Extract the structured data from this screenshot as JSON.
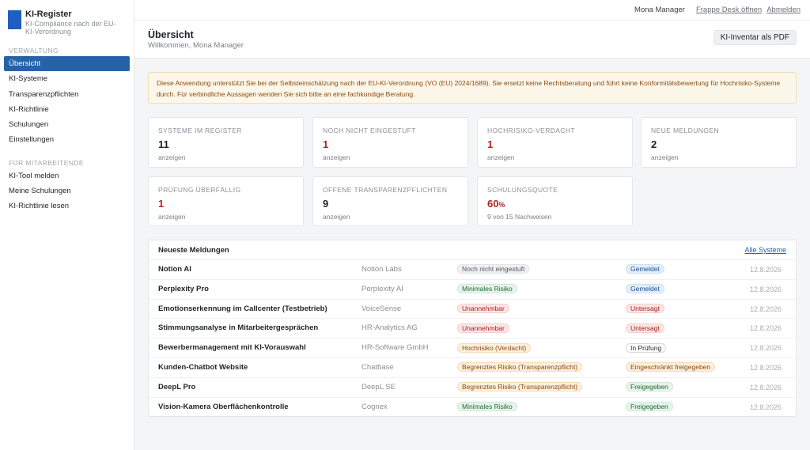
{
  "brand": {
    "title": "KI-Register",
    "subtitle": "KI-Compliance nach der EU-KI-Verordnung",
    "logo_color": "#1f5fbf"
  },
  "sidebar": {
    "section_admin": "VERWALTUNG",
    "admin_items": [
      {
        "label": "Übersicht",
        "active": true
      },
      {
        "label": "KI-Systeme"
      },
      {
        "label": "Transparenzpflichten"
      },
      {
        "label": "KI-Richtlinie"
      },
      {
        "label": "Schulungen"
      },
      {
        "label": "Einstellungen"
      }
    ],
    "section_staff": "FÜR MITARBEITENDE",
    "staff_items": [
      {
        "label": "KI-Tool melden"
      },
      {
        "label": "Meine Schulungen"
      },
      {
        "label": "KI-Richtlinie lesen"
      }
    ]
  },
  "topbar": {
    "user": "Mona Manager",
    "desk_link": "Frappe Desk öffnen",
    "logout": "Abmelden"
  },
  "page": {
    "title": "Übersicht",
    "welcome": "Willkommen, Mona Manager",
    "pdf_button": "KI-Inventar als PDF"
  },
  "notice": "Diese Anwendung unterstützt Sie bei der Selbsteinschätzung nach der EU-KI-Verordnung (VO (EU) 2024/1689). Sie ersetzt keine Rechtsberatung und führt keine Konformitätsbewertung für Hochrisiko-Systeme durch. Für verbindliche Aussagen wenden Sie sich bitte an eine fachkundige Beratung.",
  "cards": {
    "systems": {
      "label": "SYSTEME IM REGISTER",
      "value": "11",
      "foot": "anzeigen"
    },
    "unclassified": {
      "label": "NOCH NICHT EINGESTUFT",
      "value": "1",
      "foot": "anzeigen"
    },
    "highrisk": {
      "label": "HOCHRISIKO-VERDACHT",
      "value": "1",
      "foot": "anzeigen"
    },
    "new_reports": {
      "label": "NEUE MELDUNGEN",
      "value": "2",
      "foot": "anzeigen"
    },
    "overdue": {
      "label": "PRÜFUNG ÜBERFÄLLIG",
      "value": "1",
      "foot": "anzeigen"
    },
    "transparency": {
      "label": "OFFENE TRANSPARENZPFLICHTEN",
      "value": "9",
      "foot": "anzeigen"
    },
    "training": {
      "label": "SCHULUNGSQUOTE",
      "value": "60",
      "unit": "%",
      "foot": "9 von 15 Nachweisen"
    }
  },
  "reports": {
    "title": "Neueste Meldungen",
    "all_link": "Alle Systeme",
    "rows": [
      {
        "name": "Notion AI",
        "vendor": "Notion Labs",
        "risk": "Noch nicht eingestuft",
        "status": "Gemeldet",
        "date": "12.8.2026"
      },
      {
        "name": "Perplexity Pro",
        "vendor": "Perplexity AI",
        "risk": "Minimales Risiko",
        "status": "Gemeldet",
        "date": "12.8.2026"
      },
      {
        "name": "Emotionserkennung im Callcenter (Testbetrieb)",
        "vendor": "VoiceSense",
        "risk": "Unannehmbar",
        "status": "Untersagt",
        "date": "12.8.2026"
      },
      {
        "name": "Stimmungsanalyse in Mitarbeitergesprächen",
        "vendor": "HR-Analytics AG",
        "risk": "Unannehmbar",
        "status": "Untersagt",
        "date": "12.8.2026"
      },
      {
        "name": "Bewerbermanagement mit KI-Vorauswahl",
        "vendor": "HR-Software GmbH",
        "risk": "Hochrisiko (Verdacht)",
        "status": "In Prüfung",
        "date": "12.8.2026"
      },
      {
        "name": "Kunden-Chatbot Website",
        "vendor": "Chatbase",
        "risk": "Begrenztes Risiko (Transparenzpflicht)",
        "status": "Eingeschränkt freigegeben",
        "date": "12.8.2026"
      },
      {
        "name": "DeepL Pro",
        "vendor": "DeepL SE",
        "risk": "Begrenztes Risiko (Transparenzpflicht)",
        "status": "Freigegeben",
        "date": "12.8.2026"
      },
      {
        "name": "Vision-Kamera Oberflächenkontrolle",
        "vendor": "Cognex",
        "risk": "Minimales Risiko",
        "status": "Freigegeben",
        "date": "12.8.2026"
      }
    ]
  }
}
